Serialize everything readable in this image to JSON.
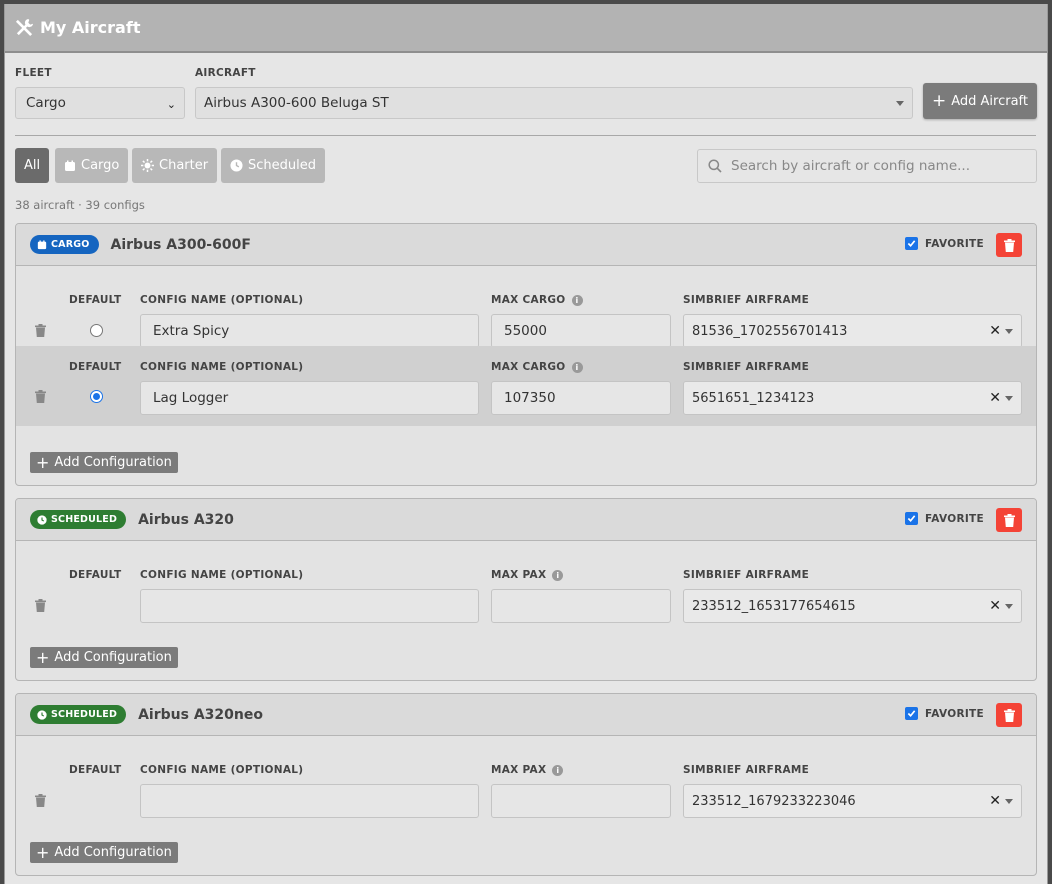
{
  "window": {
    "title": "My Aircraft"
  },
  "toolbar": {
    "fleet_label": "FLEET",
    "fleet_value": "Cargo",
    "aircraft_label": "AIRCRAFT",
    "aircraft_value": "Airbus A300-600 Beluga ST",
    "add_aircraft_label": "Add Aircraft"
  },
  "filters": [
    {
      "label": "All",
      "active": true
    },
    {
      "label": "Cargo",
      "icon": "calendar-icon"
    },
    {
      "label": "Charter",
      "icon": "sun-icon"
    },
    {
      "label": "Scheduled",
      "icon": "clock-icon"
    }
  ],
  "search": {
    "placeholder": "Search by aircraft or config name..."
  },
  "summary": "38 aircraft · 39 configs",
  "column_labels": {
    "default": "DEFAULT",
    "config_name": "CONFIG NAME (OPTIONAL)",
    "simbrief": "SIMBRIEF AIRFRAME",
    "favorite": "FAVORITE",
    "add_config": "Add Configuration"
  },
  "aircraft": [
    {
      "badge": "CARGO",
      "badge_color": "#1565c0",
      "name": "Airbus A300-600F",
      "capacity_label": "MAX CARGO",
      "favorite": true,
      "configs": [
        {
          "name": "Extra Spicy",
          "capacity": "55000",
          "airframe": "81536_1702556701413",
          "default": false
        },
        {
          "name": "Lag Logger",
          "capacity": "107350",
          "airframe": "5651651_1234123",
          "default": true
        }
      ]
    },
    {
      "badge": "SCHEDULED",
      "badge_color": "#2e7d32",
      "name": "Airbus A320",
      "capacity_label": "MAX PAX",
      "favorite": true,
      "configs": [
        {
          "name": "",
          "capacity": "",
          "airframe": "233512_1653177654615"
        }
      ]
    },
    {
      "badge": "SCHEDULED",
      "badge_color": "#2e7d32",
      "name": "Airbus A320neo",
      "capacity_label": "MAX PAX",
      "favorite": true,
      "configs": [
        {
          "name": "",
          "capacity": "",
          "airframe": "233512_1679233223046"
        }
      ]
    }
  ]
}
